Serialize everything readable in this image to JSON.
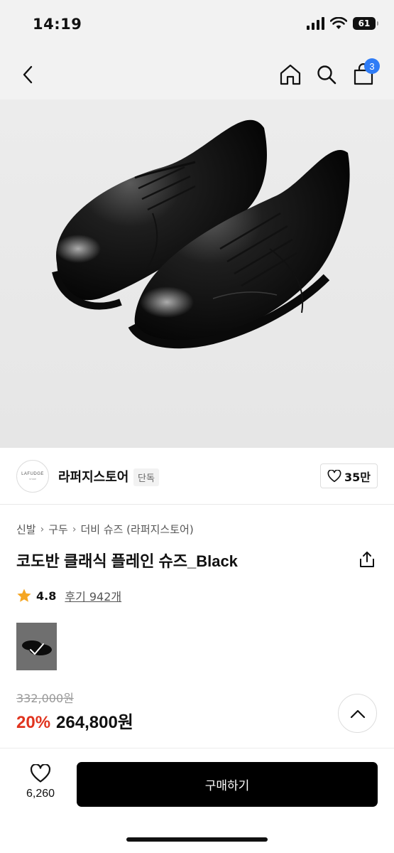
{
  "status_bar": {
    "time": "14:19",
    "battery": "61"
  },
  "nav": {
    "cart_count": "3"
  },
  "store": {
    "logo_text": "LAFUDGE",
    "logo_sub": "STORE",
    "name": "라퍼지스토어",
    "badge": "단독",
    "likes": "35만"
  },
  "breadcrumb": [
    "신발",
    "구두",
    "더비 슈즈 (라퍼지스토어)"
  ],
  "product": {
    "title": "코도반 클래식 플레인 슈즈_Black",
    "rating": "4.8",
    "reviews": "후기 942개",
    "original_price": "332,000원",
    "discount": "20%",
    "price": "264,800원"
  },
  "bottom": {
    "wish_count": "6,260",
    "buy_label": "구매하기"
  },
  "colors": {
    "accent_blue": "#2f7cf6",
    "discount_red": "#e0341f",
    "star": "#f5a623"
  }
}
